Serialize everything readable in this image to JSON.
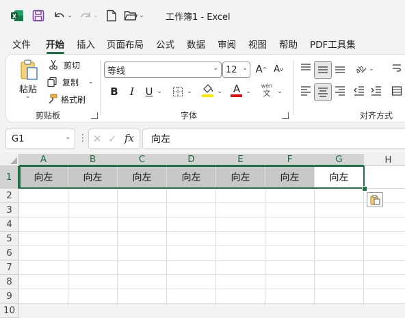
{
  "app": {
    "window_title": "工作簿1 - Excel"
  },
  "tabs": [
    "文件",
    "开始",
    "插入",
    "页面布局",
    "公式",
    "数据",
    "审阅",
    "视图",
    "帮助",
    "PDF工具集"
  ],
  "active_tab": "开始",
  "ribbon": {
    "clipboard": {
      "paste_label": "粘贴",
      "cut_label": "剪切",
      "copy_label": "复制",
      "format_painter_label": "格式刷",
      "group_label": "剪贴板"
    },
    "font": {
      "font_name": "等线",
      "font_size": "12",
      "bold": "B",
      "italic": "I",
      "underline": "U",
      "phonetic_top": "wén",
      "phonetic_bottom": "文",
      "group_label": "字体"
    },
    "alignment": {
      "group_label": "对齐方式"
    }
  },
  "formula_bar": {
    "name_box": "G1",
    "fx_label": "fx",
    "formula": "向左"
  },
  "sheet": {
    "columns": [
      "A",
      "B",
      "C",
      "D",
      "E",
      "F",
      "G",
      "H"
    ],
    "rows": [
      "1",
      "2",
      "3",
      "4",
      "5",
      "6",
      "7",
      "8",
      "9",
      "10"
    ],
    "row1_values": [
      "向左",
      "向左",
      "向左",
      "向左",
      "向左",
      "向左",
      "向左"
    ],
    "active_cell": "G1"
  },
  "colors": {
    "accent": "#1e7145",
    "excel_green": "#107c41",
    "save_purple": "#7b3fa0",
    "fill_yellow": "#ffe600",
    "font_red": "#e01010",
    "selection_fill": "#c8c8c8"
  }
}
